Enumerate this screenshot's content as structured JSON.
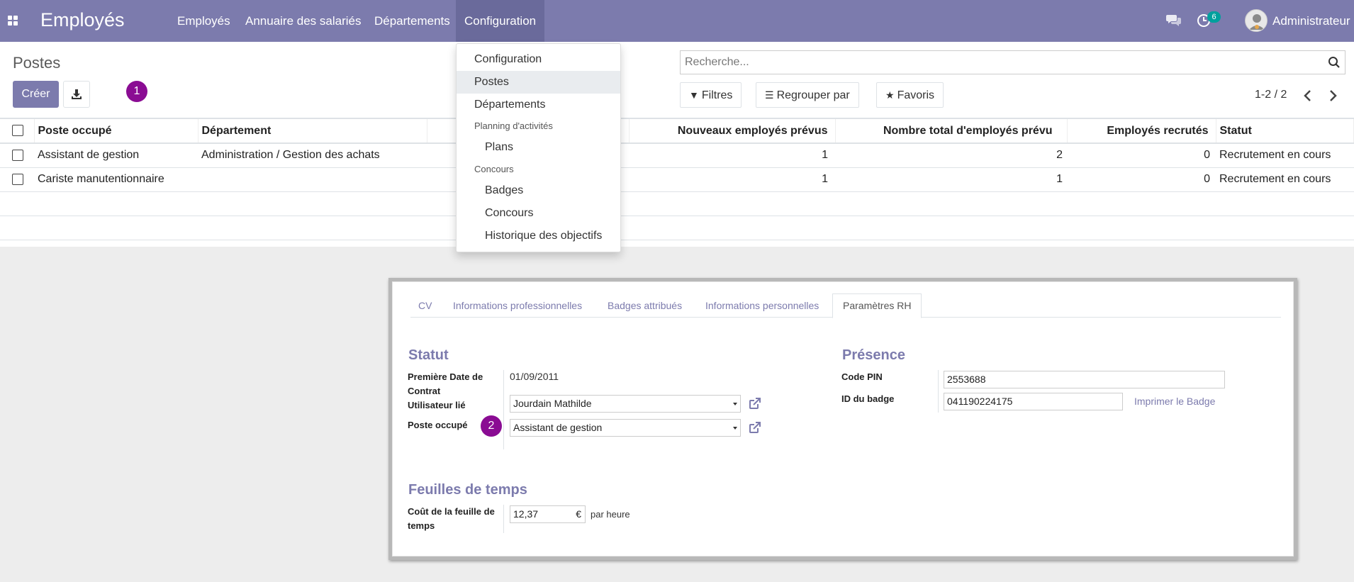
{
  "navbar": {
    "app_title": "Employés",
    "menu": [
      "Employés",
      "Annuaire des salariés",
      "Départements",
      "Configuration"
    ],
    "activity_count": "6",
    "user_name": "Administrateur"
  },
  "control_panel": {
    "breadcrumb": "Postes",
    "create_label": "Créer",
    "search_placeholder": "Recherche...",
    "filters_label": "Filtres",
    "group_by_label": "Regrouper par",
    "favorites_label": "Favoris",
    "pager": "1-2 / 2"
  },
  "annotations": {
    "step1": "1",
    "step2": "2"
  },
  "table": {
    "columns": [
      "Poste occupé",
      "Département",
      "",
      "Nouveaux employés prévus",
      "Nombre total d'employés prévu",
      "Employés recrutés",
      "Statut"
    ],
    "rows": [
      {
        "poste": "Assistant de gestion",
        "departement": "Administration / Gestion des achats",
        "nouveaux": "1",
        "total": "2",
        "recrutes": "0",
        "statut": "Recrutement en cours"
      },
      {
        "poste": "Cariste manutentionnaire",
        "departement": "",
        "nouveaux": "1",
        "total": "1",
        "recrutes": "0",
        "statut": "Recrutement en cours"
      }
    ]
  },
  "dropdown": {
    "items": {
      "configuration": "Configuration",
      "postes": "Postes",
      "departements": "Départements",
      "planning_header": "Planning d'activités",
      "plans": "Plans",
      "concours_header": "Concours",
      "badges": "Badges",
      "concours": "Concours",
      "historique": "Historique des objectifs"
    }
  },
  "form": {
    "tabs": [
      "CV",
      "Informations professionnelles",
      "Badges attribués",
      "Informations personnelles",
      "Paramètres RH"
    ],
    "statut_title": "Statut",
    "premiere_date_label": "Première Date de Contrat",
    "premiere_date_value": "01/09/2011",
    "utilisateur_label": "Utilisateur lié",
    "utilisateur_value": "Jourdain Mathilde",
    "poste_label": "Poste occupé",
    "poste_value": "Assistant de gestion",
    "presence_title": "Présence",
    "code_pin_label": "Code PIN",
    "code_pin_value": "2553688",
    "badge_label": "ID du badge",
    "badge_value": "041190224175",
    "print_badge": "Imprimer le Badge",
    "timesheet_title": "Feuilles de temps",
    "cost_label": "Coût de la feuille de temps",
    "cost_value": "12,37",
    "cost_currency": "€",
    "cost_unit": "par heure"
  }
}
